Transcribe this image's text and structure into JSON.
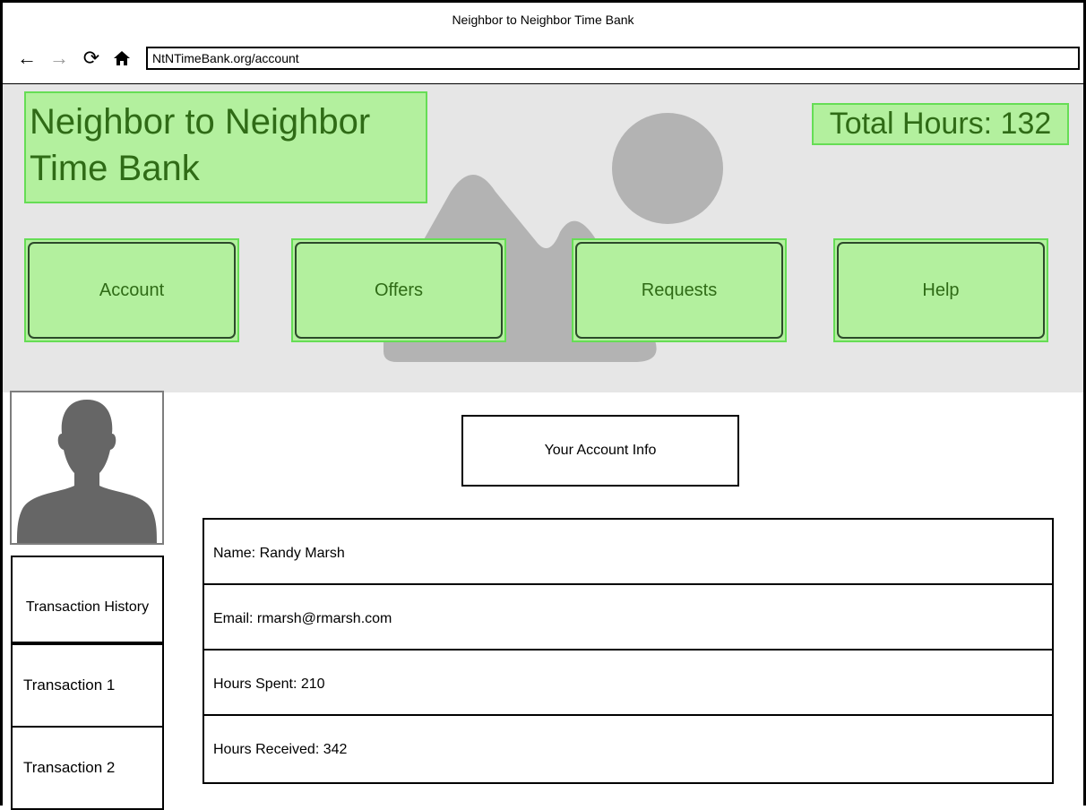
{
  "browser": {
    "window_title": "Neighbor to Neighbor Time Bank",
    "url": "NtNTimeBank.org/account",
    "icons": [
      "back-arrow-icon",
      "forward-arrow-icon",
      "reload-icon",
      "home-icon"
    ]
  },
  "header": {
    "site_title": "Neighbor to Neighbor Time Bank",
    "total_hours": "Total Hours: 132",
    "nav": [
      {
        "label": "Account"
      },
      {
        "label": "Offers"
      },
      {
        "label": "Requests"
      },
      {
        "label": "Help"
      }
    ]
  },
  "sidebar": {
    "transaction_history_label": "Transaction History",
    "transactions": [
      {
        "label": "Transaction 1"
      },
      {
        "label": "Transaction 2"
      }
    ]
  },
  "account": {
    "heading": "Your Account Info",
    "fields": [
      {
        "text": "Name: Randy Marsh"
      },
      {
        "text": "Email: rmarsh@rmarsh.com"
      },
      {
        "text": "Hours Spent: 210"
      },
      {
        "text": "Hours Received: 342"
      }
    ]
  },
  "colors": {
    "accent_fill": "#b3f09e",
    "accent_border": "#66dd55",
    "accent_text": "#2f6b16",
    "header_bg": "#e6e6e6",
    "placeholder_gray": "#b3b3b3"
  }
}
